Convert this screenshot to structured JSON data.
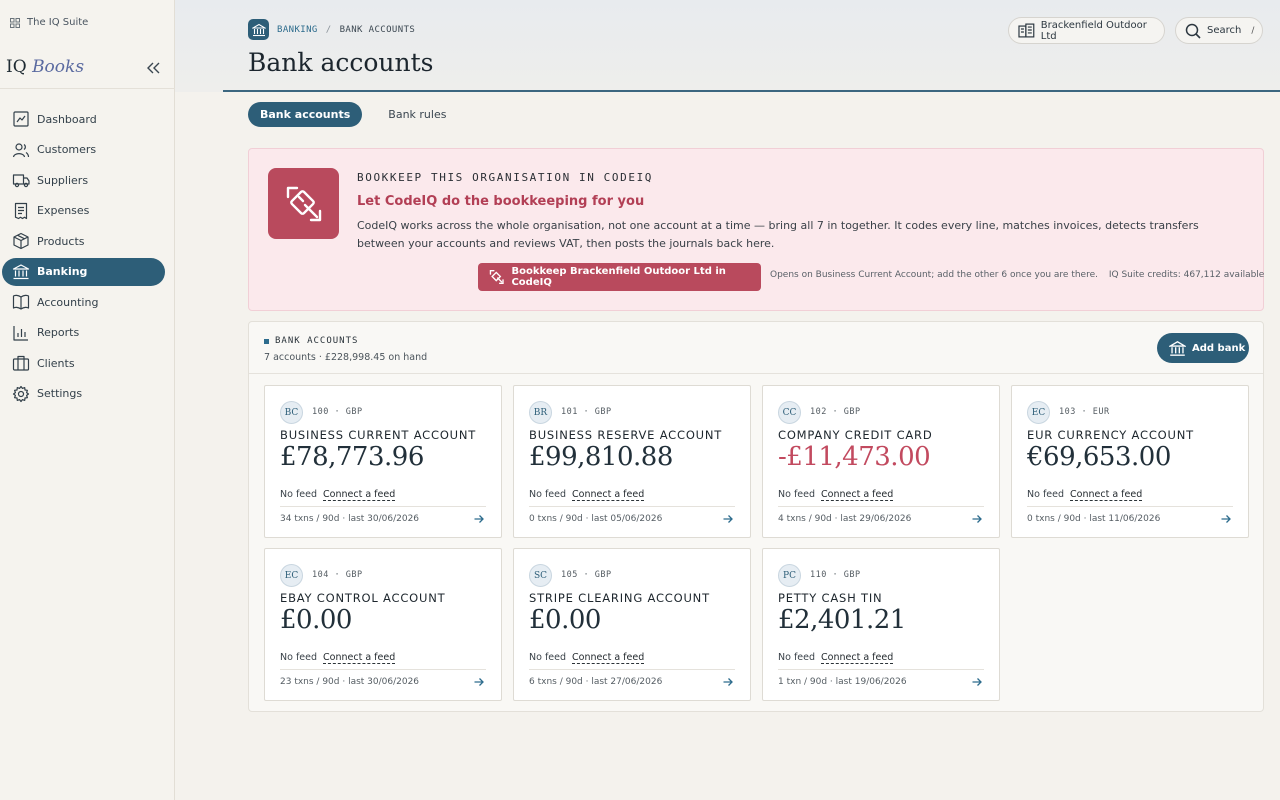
{
  "suite": {
    "label": "The IQ Suite"
  },
  "brand": {
    "part1": "IQ",
    "part2": "Books"
  },
  "sidebar": {
    "items": [
      {
        "label": "Dashboard",
        "icon": "dashboard-icon",
        "active": false
      },
      {
        "label": "Customers",
        "icon": "customers-icon",
        "active": false
      },
      {
        "label": "Suppliers",
        "icon": "truck-icon",
        "active": false
      },
      {
        "label": "Expenses",
        "icon": "receipt-icon",
        "active": false
      },
      {
        "label": "Products",
        "icon": "box-icon",
        "active": false
      },
      {
        "label": "Banking",
        "icon": "bank-icon",
        "active": true
      },
      {
        "label": "Accounting",
        "icon": "book-icon",
        "active": false
      },
      {
        "label": "Reports",
        "icon": "chart-icon",
        "active": false
      },
      {
        "label": "Clients",
        "icon": "briefcase-icon",
        "active": false
      },
      {
        "label": "Settings",
        "icon": "gear-icon",
        "active": false
      }
    ]
  },
  "header": {
    "breadcrumb_section": "BANKING",
    "breadcrumb_sep": "/",
    "breadcrumb_page": "BANK ACCOUNTS",
    "title": "Bank accounts",
    "org_name": "Brackenfield Outdoor Ltd",
    "search_label": "Search",
    "search_shortcut": "/"
  },
  "tabs": [
    {
      "label": "Bank accounts",
      "active": true
    },
    {
      "label": "Bank rules",
      "active": false
    }
  ],
  "promo": {
    "kicker": "BOOKKEEP THIS ORGANISATION IN CODEIQ",
    "headline": "Let CodeIQ do the bookkeeping for you",
    "body": "CodeIQ works across the whole organisation, not one account at a time — bring all 7 in together. It codes every line, matches invoices, detects transfers between your accounts and reviews VAT, then posts the journals back here.",
    "button_label": "Bookkeep Brackenfield Outdoor Ltd in CodeIQ",
    "note": "Opens on Business Current Account; add the other 6 once you are there.",
    "credits": "IQ Suite credits: 467,112 available"
  },
  "accounts_panel": {
    "kicker": "BANK ACCOUNTS",
    "summary": "7 accounts · £228,998.45 on hand",
    "add_button": "Add bank",
    "feed_status": "No feed",
    "connect_label": "Connect a feed",
    "accounts": [
      {
        "badge": "BC",
        "code": "100 · GBP",
        "name": "BUSINESS CURRENT ACCOUNT",
        "balance": "£78,773.96",
        "negative": false,
        "stats": "34 txns / 90d · last 30/06/2026"
      },
      {
        "badge": "BR",
        "code": "101 · GBP",
        "name": "BUSINESS RESERVE ACCOUNT",
        "balance": "£99,810.88",
        "negative": false,
        "stats": "0 txns / 90d · last 05/06/2026"
      },
      {
        "badge": "CC",
        "code": "102 · GBP",
        "name": "COMPANY CREDIT CARD",
        "balance": "-£11,473.00",
        "negative": true,
        "stats": "4 txns / 90d · last 29/06/2026"
      },
      {
        "badge": "EC",
        "code": "103 · EUR",
        "name": "EUR CURRENCY ACCOUNT",
        "balance": "€69,653.00",
        "negative": false,
        "stats": "0 txns / 90d · last 11/06/2026"
      },
      {
        "badge": "EC",
        "code": "104 · GBP",
        "name": "EBAY CONTROL ACCOUNT",
        "balance": "£0.00",
        "negative": false,
        "stats": "23 txns / 90d · last 30/06/2026"
      },
      {
        "badge": "SC",
        "code": "105 · GBP",
        "name": "STRIPE CLEARING ACCOUNT",
        "balance": "£0.00",
        "negative": false,
        "stats": "6 txns / 90d · last 27/06/2026"
      },
      {
        "badge": "PC",
        "code": "110 · GBP",
        "name": "PETTY CASH TIN",
        "balance": "£2,401.21",
        "negative": false,
        "stats": "1 txn / 90d · last 19/06/2026"
      }
    ]
  },
  "colors": {
    "accent": "#2d5e78",
    "promo": "#b94a5d",
    "negative": "#c24a5f"
  }
}
